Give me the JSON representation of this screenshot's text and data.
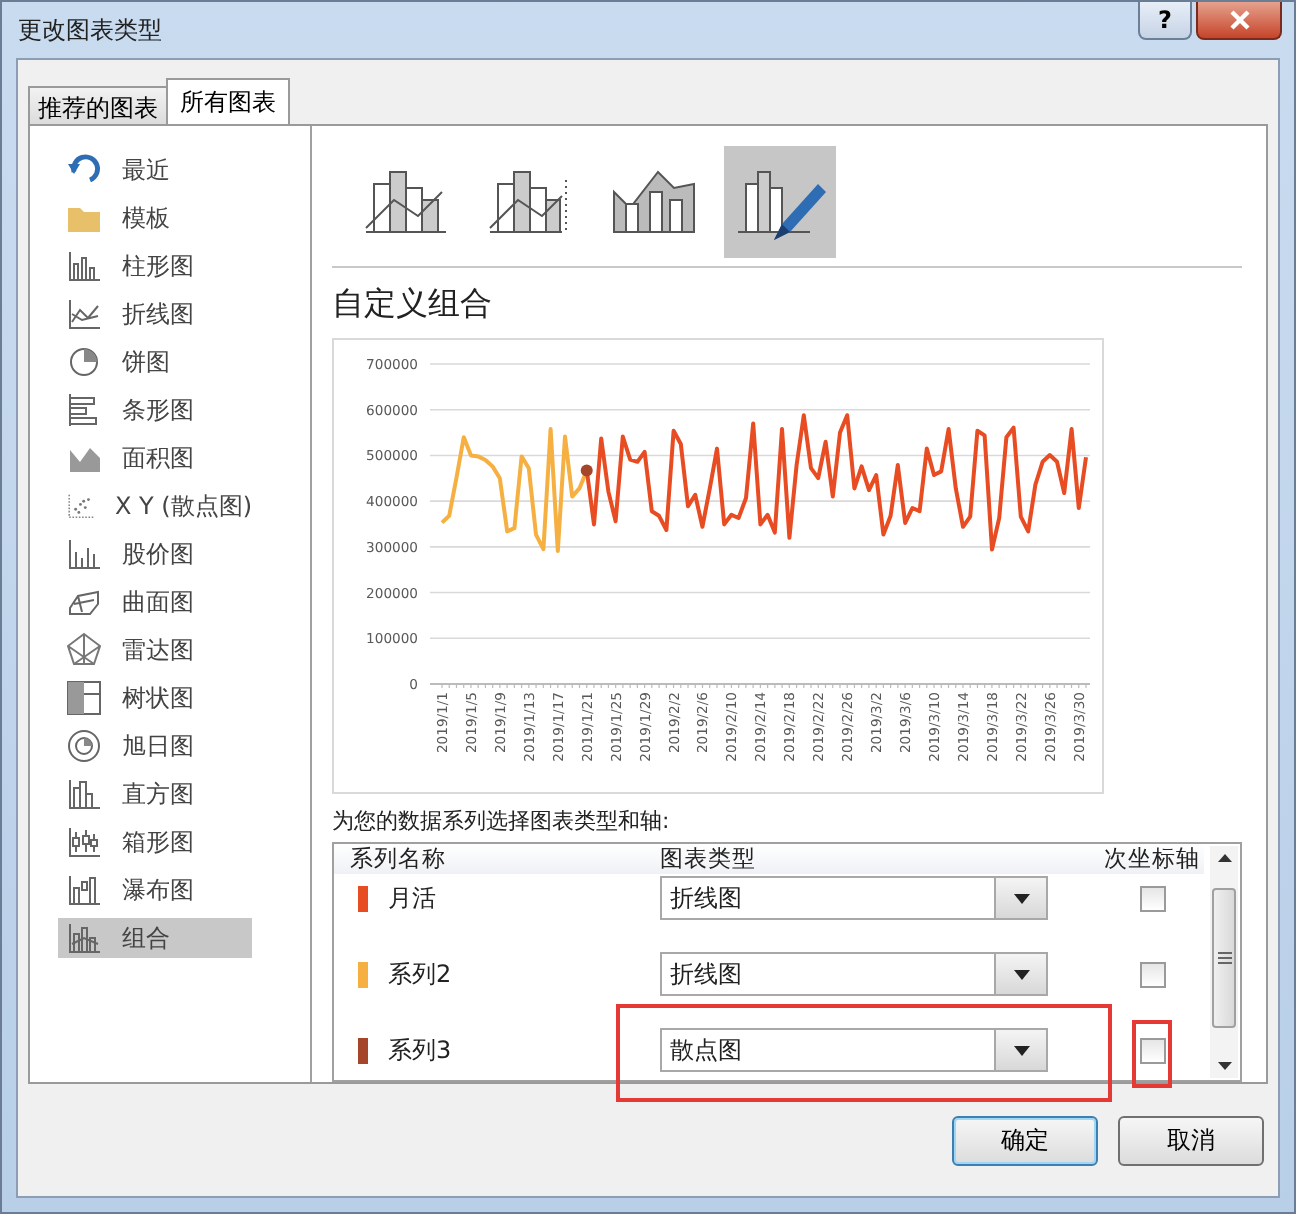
{
  "window": {
    "title": "更改图表类型",
    "help_button": "?"
  },
  "tabs": [
    {
      "label": "推荐的图表",
      "selected": false
    },
    {
      "label": "所有图表",
      "selected": true
    }
  ],
  "sidebar": {
    "items": [
      {
        "label": "最近",
        "selected": false
      },
      {
        "label": "模板",
        "selected": false
      },
      {
        "label": "柱形图",
        "selected": false
      },
      {
        "label": "折线图",
        "selected": false
      },
      {
        "label": "饼图",
        "selected": false
      },
      {
        "label": "条形图",
        "selected": false
      },
      {
        "label": "面积图",
        "selected": false
      },
      {
        "label": "X Y (散点图)",
        "selected": false
      },
      {
        "label": "股价图",
        "selected": false
      },
      {
        "label": "曲面图",
        "selected": false
      },
      {
        "label": "雷达图",
        "selected": false
      },
      {
        "label": "树状图",
        "selected": false
      },
      {
        "label": "旭日图",
        "selected": false
      },
      {
        "label": "直方图",
        "selected": false
      },
      {
        "label": "箱形图",
        "selected": false
      },
      {
        "label": "瀑布图",
        "selected": false
      },
      {
        "label": "组合",
        "selected": true
      }
    ]
  },
  "subtypes": [
    {
      "selected": false
    },
    {
      "selected": false
    },
    {
      "selected": false
    },
    {
      "selected": true
    }
  ],
  "heading": "自定义组合",
  "chart_data": {
    "type": "line",
    "grid": true,
    "ylim": [
      0,
      700000
    ],
    "categories": [
      "2019/1/1",
      null,
      null,
      null,
      "2019/1/5",
      null,
      null,
      null,
      "2019/1/9",
      null,
      null,
      null,
      "2019/1/13",
      null,
      null,
      null,
      "2019/1/17",
      null,
      null,
      null,
      "2019/1/21",
      null,
      null,
      null,
      "2019/1/25",
      null,
      null,
      null,
      "2019/1/29",
      null,
      null,
      null,
      "2019/2/2",
      null,
      null,
      null,
      "2019/2/6",
      null,
      null,
      null,
      "2019/2/10",
      null,
      null,
      null,
      "2019/2/14",
      null,
      null,
      null,
      "2019/2/18",
      null,
      null,
      null,
      "2019/2/22",
      null,
      null,
      null,
      "2019/2/26",
      null,
      null,
      null,
      "2019/3/2",
      null,
      null,
      null,
      "2019/3/6",
      null,
      null,
      null,
      "2019/3/10",
      null,
      null,
      null,
      "2019/3/14",
      null,
      null,
      null,
      "2019/3/18",
      null,
      null,
      null,
      "2019/3/22",
      null,
      null,
      null,
      "2019/3/26",
      null,
      null,
      null,
      "2019/3/30",
      null
    ],
    "yticks": [
      0,
      100000,
      200000,
      300000,
      400000,
      500000,
      600000,
      700000
    ],
    "series": [
      {
        "color": "#f5b041",
        "marker": false,
        "values": [
          353000,
          368000,
          450000,
          540000,
          500000,
          498000,
          490000,
          476000,
          450000,
          334000,
          341000,
          498000,
          472000,
          327000,
          295000,
          558000,
          291000,
          541000,
          410000,
          428000,
          467000,
          null,
          null,
          null,
          null,
          null,
          null,
          null,
          null,
          null,
          null,
          null,
          null,
          null,
          null,
          null,
          null,
          null,
          null,
          null,
          null,
          null,
          null,
          null,
          null,
          null,
          null,
          null,
          null,
          null,
          null,
          null,
          null,
          null,
          null,
          null,
          null,
          null,
          null,
          null,
          null,
          null,
          null,
          null,
          null,
          null,
          null,
          null,
          null,
          null,
          null,
          null,
          null,
          null,
          null,
          null,
          null,
          null,
          null,
          null,
          null,
          null,
          null,
          null,
          null,
          null,
          null,
          null,
          null,
          null
        ]
      },
      {
        "color": "#e84c22",
        "marker": false,
        "values": [
          null,
          null,
          null,
          null,
          null,
          null,
          null,
          null,
          null,
          null,
          null,
          null,
          null,
          null,
          null,
          null,
          null,
          null,
          null,
          null,
          467000,
          349000,
          537000,
          421000,
          356000,
          541000,
          491000,
          486000,
          508000,
          378000,
          368000,
          337000,
          554000,
          525000,
          389000,
          414000,
          344000,
          428000,
          515000,
          349000,
          370000,
          363000,
          407000,
          570000,
          349000,
          370000,
          331000,
          558000,
          320000,
          479000,
          588000,
          472000,
          450000,
          530000,
          410000,
          550000,
          588000,
          428000,
          476000,
          424000,
          457000,
          327000,
          368000,
          479000,
          352000,
          385000,
          378000,
          515000,
          457000,
          465000,
          558000,
          428000,
          344000,
          366000,
          554000,
          544000,
          294000,
          363000,
          540000,
          561000,
          366000,
          334000,
          436000,
          486000,
          501000,
          486000,
          418000,
          558000,
          385000,
          496000
        ]
      },
      {
        "color": "#a5462a",
        "marker": true,
        "values": [
          null,
          null,
          null,
          null,
          null,
          null,
          null,
          null,
          null,
          null,
          null,
          null,
          null,
          null,
          null,
          null,
          null,
          null,
          null,
          null,
          467000,
          null,
          null,
          null,
          null,
          null,
          null,
          null,
          null,
          null,
          null,
          null,
          null,
          null,
          null,
          null,
          null,
          null,
          null,
          null,
          null,
          null,
          null,
          null,
          null,
          null,
          null,
          null,
          null,
          null,
          null,
          null,
          null,
          null,
          null,
          null,
          null,
          null,
          null,
          null,
          null,
          null,
          null,
          null,
          null,
          null,
          null,
          null,
          null,
          null,
          null,
          null,
          null,
          null,
          null,
          null,
          null,
          null,
          null,
          null,
          null,
          null,
          null,
          null,
          null,
          null,
          null,
          null,
          null,
          null
        ]
      }
    ]
  },
  "prompt": "为您的数据系列选择图表类型和轴:",
  "series_table": {
    "columns": [
      "系列名称",
      "图表类型",
      "次坐标轴"
    ],
    "rows": [
      {
        "name": "月活",
        "color": "#e84c22",
        "chart_type": "折线图",
        "secondary_axis": false,
        "highlighted": false
      },
      {
        "name": "系列2",
        "color": "#f5b041",
        "chart_type": "折线图",
        "secondary_axis": false,
        "highlighted": false
      },
      {
        "name": "系列3",
        "color": "#a5462a",
        "chart_type": "散点图",
        "secondary_axis": false,
        "highlighted": true
      }
    ]
  },
  "buttons": [
    {
      "label": "确定",
      "default": true
    },
    {
      "label": "取消",
      "default": false
    }
  ]
}
